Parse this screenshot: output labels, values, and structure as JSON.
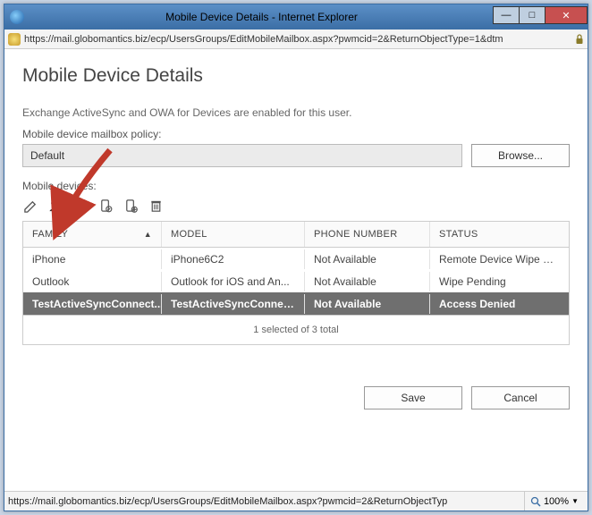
{
  "window": {
    "title": "Mobile Device Details - Internet Explorer",
    "min": "—",
    "max": "□",
    "close": "✕"
  },
  "address": "https://mail.globomantics.biz/ecp/UsersGroups/EditMobileMailbox.aspx?pwmcid=2&ReturnObjectType=1&dtm",
  "page": {
    "heading": "Mobile Device Details",
    "info_text": "Exchange ActiveSync and OWA for Devices are enabled for this user.",
    "policy_label": "Mobile device mailbox policy:",
    "policy_value": "Default",
    "browse_btn": "Browse...",
    "devices_label": "Mobile devices:",
    "columns": {
      "family": "FAMILY",
      "model": "MODEL",
      "phone": "PHONE NUMBER",
      "status": "STATUS"
    },
    "rows": [
      {
        "family": "iPhone",
        "model": "iPhone6C2",
        "phone": "Not Available",
        "status": "Remote Device Wipe Su...",
        "selected": false
      },
      {
        "family": "Outlook",
        "model": "Outlook for iOS and An...",
        "phone": "Not Available",
        "status": "Wipe Pending",
        "selected": false
      },
      {
        "family": "TestActiveSyncConnect...",
        "model": "TestActiveSyncConnect...",
        "phone": "Not Available",
        "status": "Access Denied",
        "selected": true
      }
    ],
    "footer": "1 selected of 3 total",
    "save_btn": "Save",
    "cancel_btn": "Cancel"
  },
  "status": {
    "url": "https://mail.globomantics.biz/ecp/UsersGroups/EditMobileMailbox.aspx?pwmcid=2&ReturnObjectTyp",
    "zoom": "100%"
  },
  "toolbar_icons": [
    "edit",
    "allow-user",
    "block-user",
    "wipe-device",
    "wipe-account",
    "delete"
  ]
}
